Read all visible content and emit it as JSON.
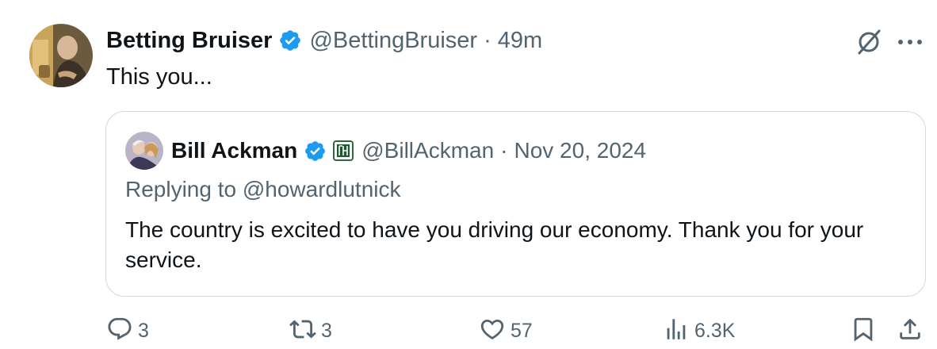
{
  "tweet": {
    "author_name": "Betting Bruiser",
    "author_handle": "@BettingBruiser",
    "separator": "·",
    "time": "49m",
    "text": "This you..."
  },
  "quote": {
    "author_name": "Bill Ackman",
    "author_handle": "@BillAckman",
    "separator": "·",
    "date": "Nov 20, 2024",
    "replying_to": "Replying to @howardlutnick",
    "text": "The country is excited to have you driving our economy. Thank you for your service."
  },
  "actions": {
    "replies": "3",
    "reposts": "3",
    "likes": "57",
    "views": "6.3K"
  },
  "icons": {
    "verified": "verified-badge-icon",
    "grok": "grok-icon",
    "more": "more-icon",
    "reply": "reply-icon",
    "repost": "repost-icon",
    "like": "heart-icon",
    "views": "views-icon",
    "bookmark": "bookmark-icon",
    "share": "share-icon"
  },
  "colors": {
    "verified_blue": "#1d9bf0",
    "text_primary": "#0f1419",
    "text_secondary": "#536471",
    "border": "#cfd9de"
  }
}
